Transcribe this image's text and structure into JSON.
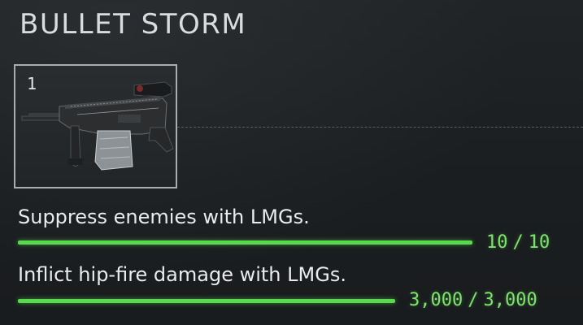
{
  "header": {
    "title": "BULLET STORM"
  },
  "reward_tile": {
    "slot_number": "1",
    "weapon_icon": "lmg-weapon-icon"
  },
  "challenges": [
    {
      "label": "Suppress enemies with LMGs.",
      "current": "10",
      "total": "10",
      "separator": "/",
      "progress_fraction": 1.0
    },
    {
      "label": "Inflict hip-fire damage with LMGs.",
      "current": "3,000",
      "total": "3,000",
      "separator": "/",
      "progress_fraction": 1.0
    }
  ],
  "colors": {
    "progress_green": "#58d94e",
    "progress_text": "#7ee36e",
    "tile_border": "#a9adb0"
  }
}
